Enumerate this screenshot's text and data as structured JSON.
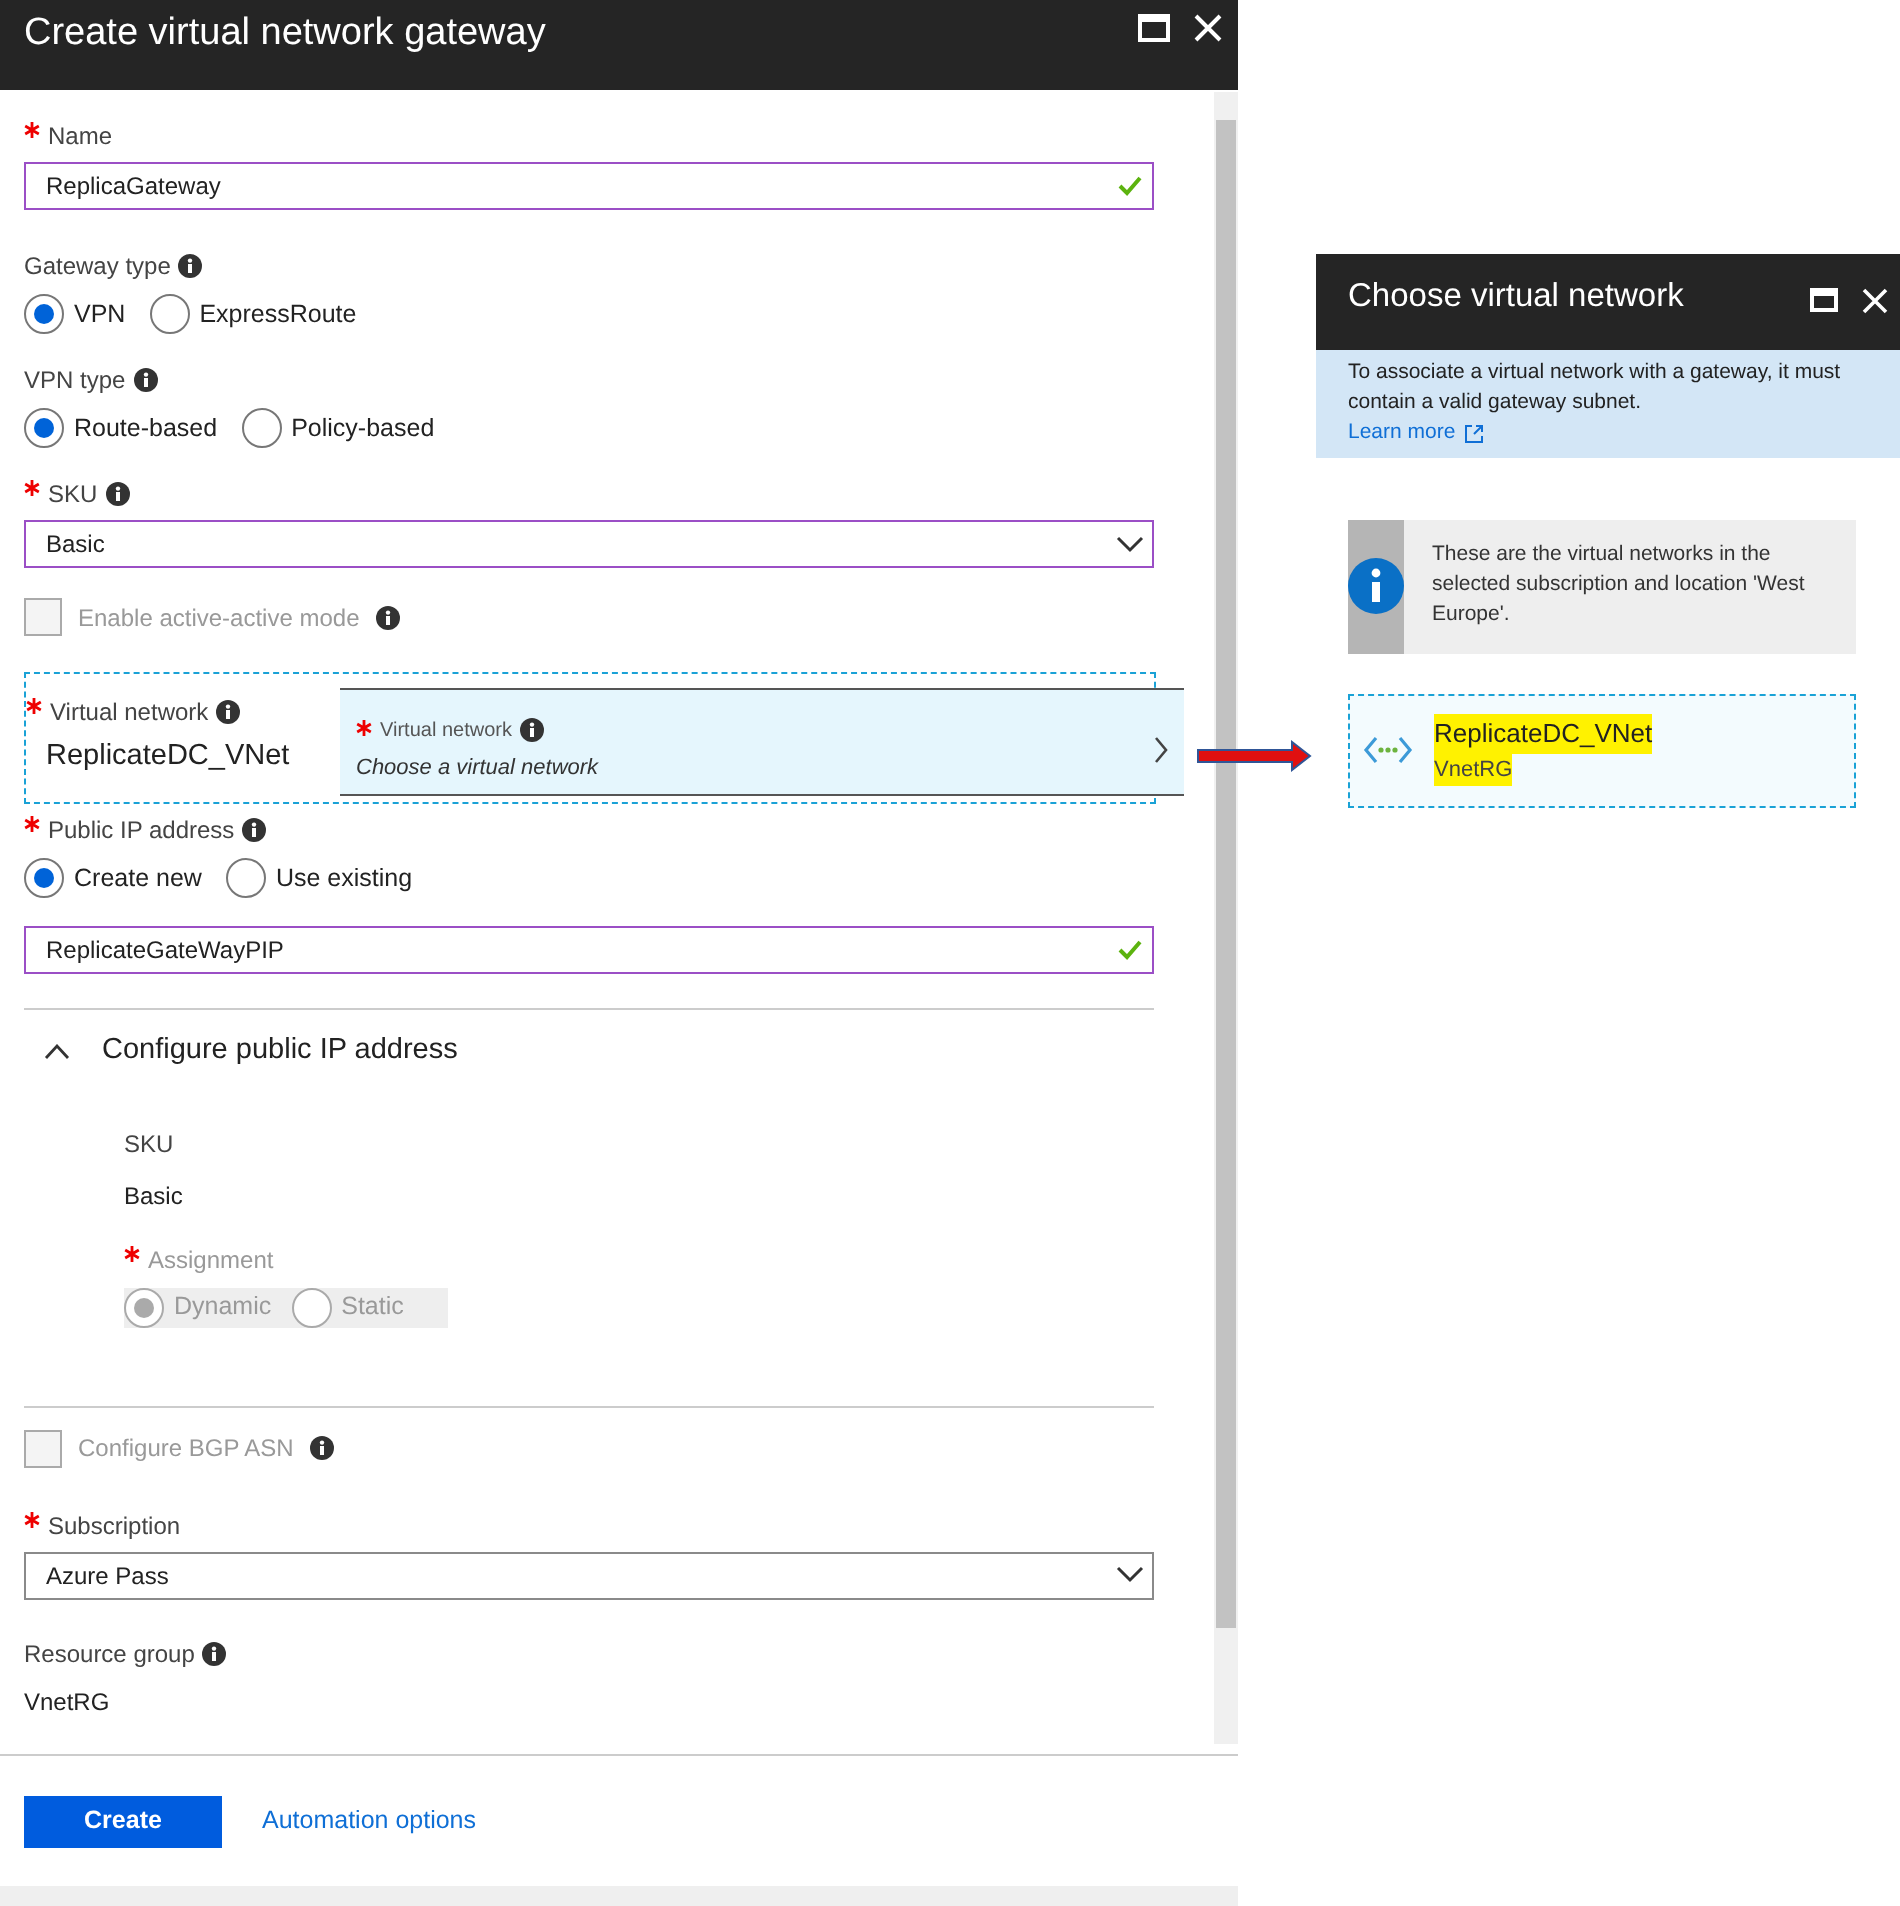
{
  "create_blade": {
    "title": "Create virtual network gateway",
    "name": {
      "label": "Name",
      "required": true,
      "value": "ReplicaGateway",
      "valid": true
    },
    "gateway_type": {
      "label": "Gateway type",
      "options": [
        {
          "label": "VPN",
          "selected": true
        },
        {
          "label": "ExpressRoute",
          "selected": false
        }
      ]
    },
    "vpn_type": {
      "label": "VPN type",
      "options": [
        {
          "label": "Route-based",
          "selected": true
        },
        {
          "label": "Policy-based",
          "selected": false
        }
      ]
    },
    "sku": {
      "label": "SKU",
      "required": true,
      "value": "Basic"
    },
    "active_active": {
      "label": "Enable active-active mode",
      "checked": false,
      "disabled": true
    },
    "virtual_network": {
      "label": "Virtual network",
      "required": true,
      "value": "ReplicateDC_VNet",
      "picker": {
        "label": "Virtual network",
        "required": true,
        "prompt": "Choose a virtual network"
      }
    },
    "public_ip": {
      "label": "Public IP address",
      "required": true,
      "options": [
        {
          "label": "Create new",
          "selected": true
        },
        {
          "label": "Use existing",
          "selected": false
        }
      ],
      "value": "ReplicateGateWayPIP",
      "valid": true
    },
    "configure_section": {
      "title": "Configure public IP address",
      "expanded": true,
      "sku_label": "SKU",
      "sku_value": "Basic",
      "assignment": {
        "label": "Assignment",
        "required": true,
        "disabled": true,
        "options": [
          {
            "label": "Dynamic",
            "selected": true
          },
          {
            "label": "Static",
            "selected": false
          }
        ]
      }
    },
    "bgp": {
      "label": "Configure BGP ASN",
      "checked": false,
      "disabled": true
    },
    "subscription": {
      "label": "Subscription",
      "required": true,
      "value": "Azure Pass"
    },
    "resource_group": {
      "label": "Resource group",
      "value": "VnetRG"
    },
    "create_button": "Create",
    "automation_link": "Automation options"
  },
  "choose_blade": {
    "title": "Choose virtual network",
    "notice": "To associate a virtual network with a gateway, it must contain a valid gateway subnet.",
    "learn_more": "Learn more",
    "info": "These are the virtual networks in the selected subscription and location 'West Europe'.",
    "networks": [
      {
        "name": "ReplicateDC_VNet",
        "group": "VnetRG",
        "highlighted": true
      }
    ]
  }
}
